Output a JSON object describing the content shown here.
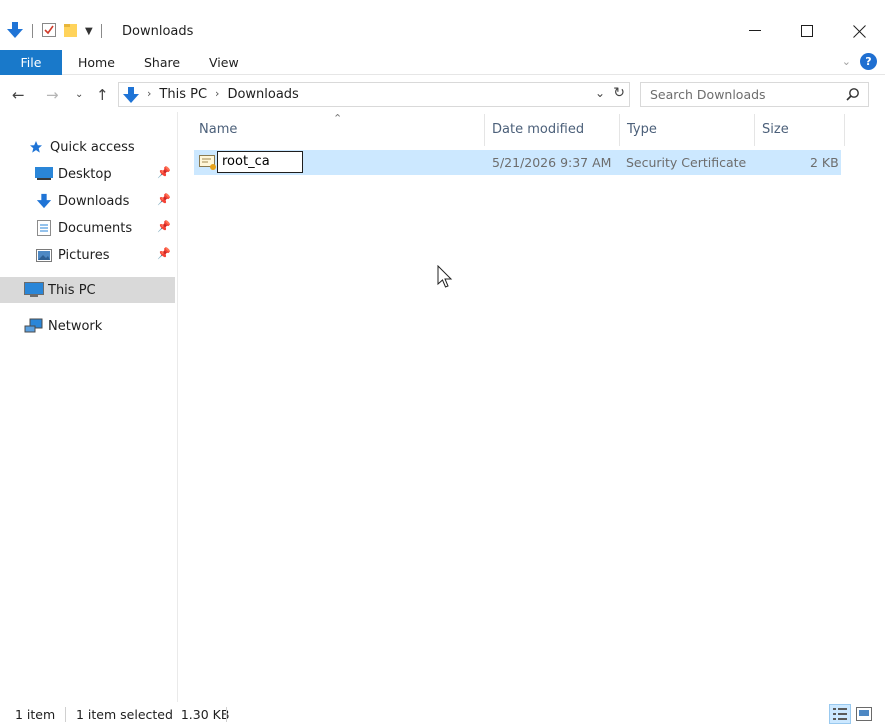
{
  "window": {
    "title": "Downloads"
  },
  "ribbon": {
    "tabs": [
      "File",
      "Home",
      "Share",
      "View"
    ]
  },
  "address": {
    "crumbs": [
      "This PC",
      "Downloads"
    ]
  },
  "search": {
    "placeholder": "Search Downloads"
  },
  "nav": {
    "quick_access": "Quick access",
    "pinned": [
      "Desktop",
      "Downloads",
      "Documents",
      "Pictures"
    ],
    "this_pc": "This PC",
    "network": "Network"
  },
  "columns": {
    "name": "Name",
    "date": "Date modified",
    "type": "Type",
    "size": "Size"
  },
  "files": [
    {
      "name": "root_ca",
      "date": "5/21/2026 9:37 AM",
      "type": "Security Certificate",
      "size": "2 KB"
    }
  ],
  "status": {
    "count": "1 item",
    "selection": "1 item selected  1.30 KB"
  },
  "colors": {
    "accent": "#1979ca",
    "selection": "#cce8ff",
    "nav_selected": "#d9d9d9"
  }
}
